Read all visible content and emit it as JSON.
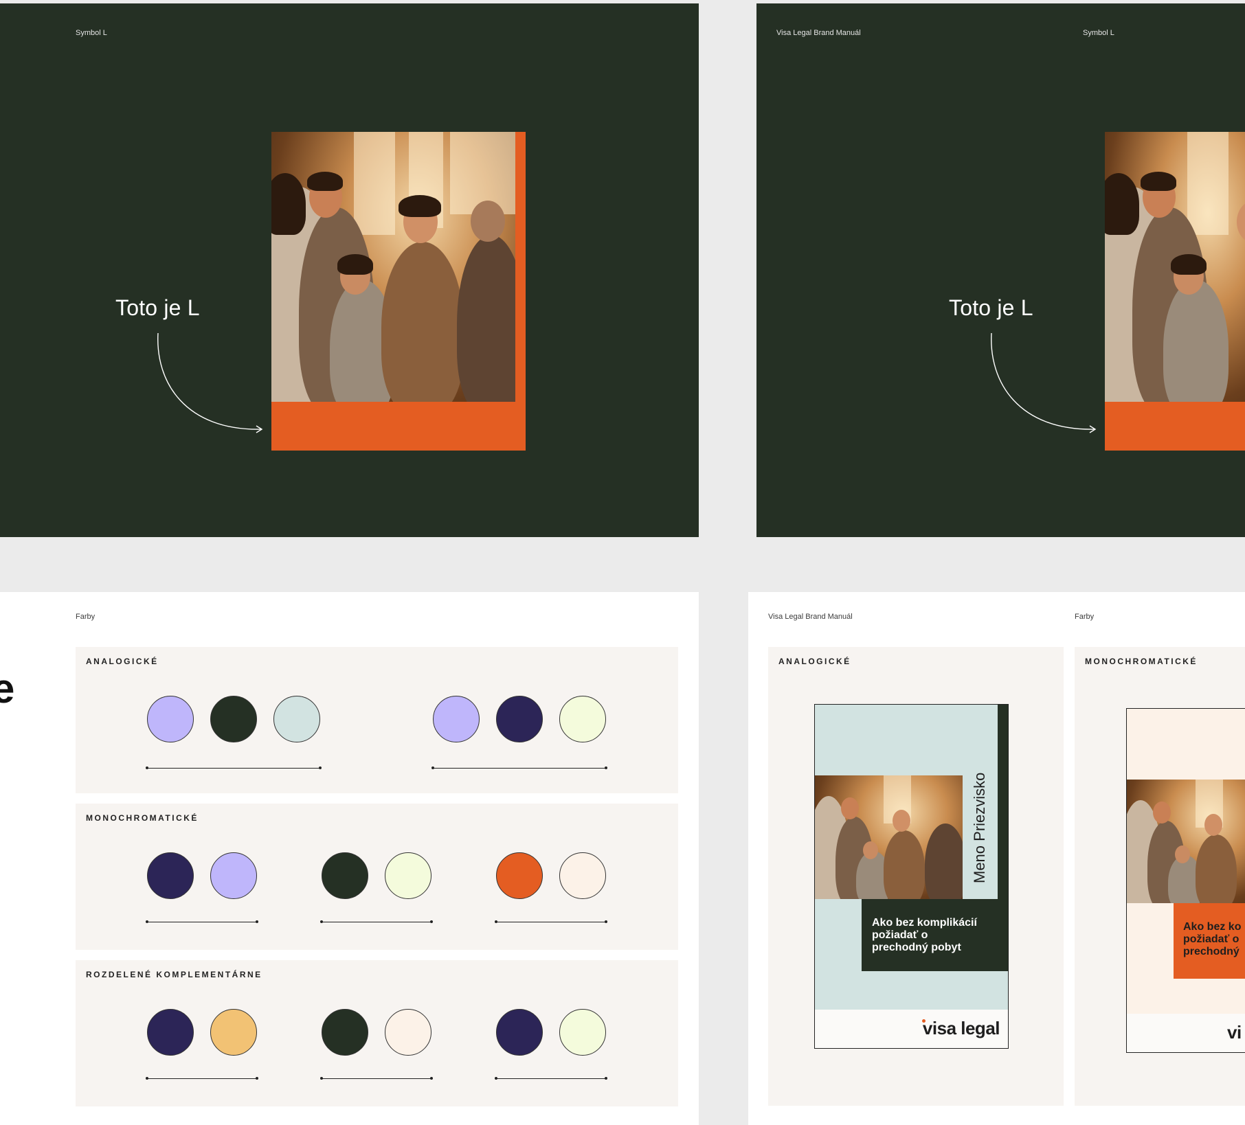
{
  "slides": {
    "symbol_left": {
      "section": "Symbol L",
      "callout": "Toto je L"
    },
    "symbol_right": {
      "brand": "Visa Legal Brand Manuál",
      "section": "Symbol L",
      "callout": "Toto je L"
    },
    "colors_left": {
      "section": "Farby",
      "edge_glyph": "e",
      "groups": [
        {
          "title": "ANALOGICKÉ",
          "swatches": [
            "#bfb6fb",
            "#253024",
            "#d2e3e1",
            "#bfb6fb",
            "#2c2557",
            "#f4fbdc"
          ]
        },
        {
          "title": "MONOCHROMATICKÉ",
          "swatches": [
            "#2c2557",
            "#bfb6fb",
            "#253024",
            "#f4fbdc",
            "#e45d22",
            "#fcf2e8"
          ]
        },
        {
          "title": "ROZDELENÉ KOMPLEMENTÁRNE",
          "swatches": [
            "#2c2557",
            "#f2c274",
            "#253024",
            "#fcf2e8",
            "#2c2557",
            "#f4fbdc"
          ]
        }
      ]
    },
    "colors_right": {
      "brand": "Visa Legal Brand Manuál",
      "section": "Farby",
      "poster_a": {
        "label": "ANALOGICKÉ",
        "name": "Meno Priezvisko",
        "headline": "Ako bez komplikácií\npožiadať o\nprechodný pobyt",
        "logo": "visa legal"
      },
      "poster_b": {
        "label": "MONOCHROMATICKÉ",
        "headline": "Ako bez ko\npožiadať o\nprechodný",
        "logo": "vi"
      }
    }
  },
  "colors": {
    "dark_green": "#253024",
    "orange": "#e45d22",
    "lavender": "#bfb6fb",
    "navy": "#2c2557",
    "mint": "#d2e3e1",
    "lime_cream": "#f4fbdc",
    "peach_cream": "#fcf2e8",
    "sand": "#f2c274"
  }
}
